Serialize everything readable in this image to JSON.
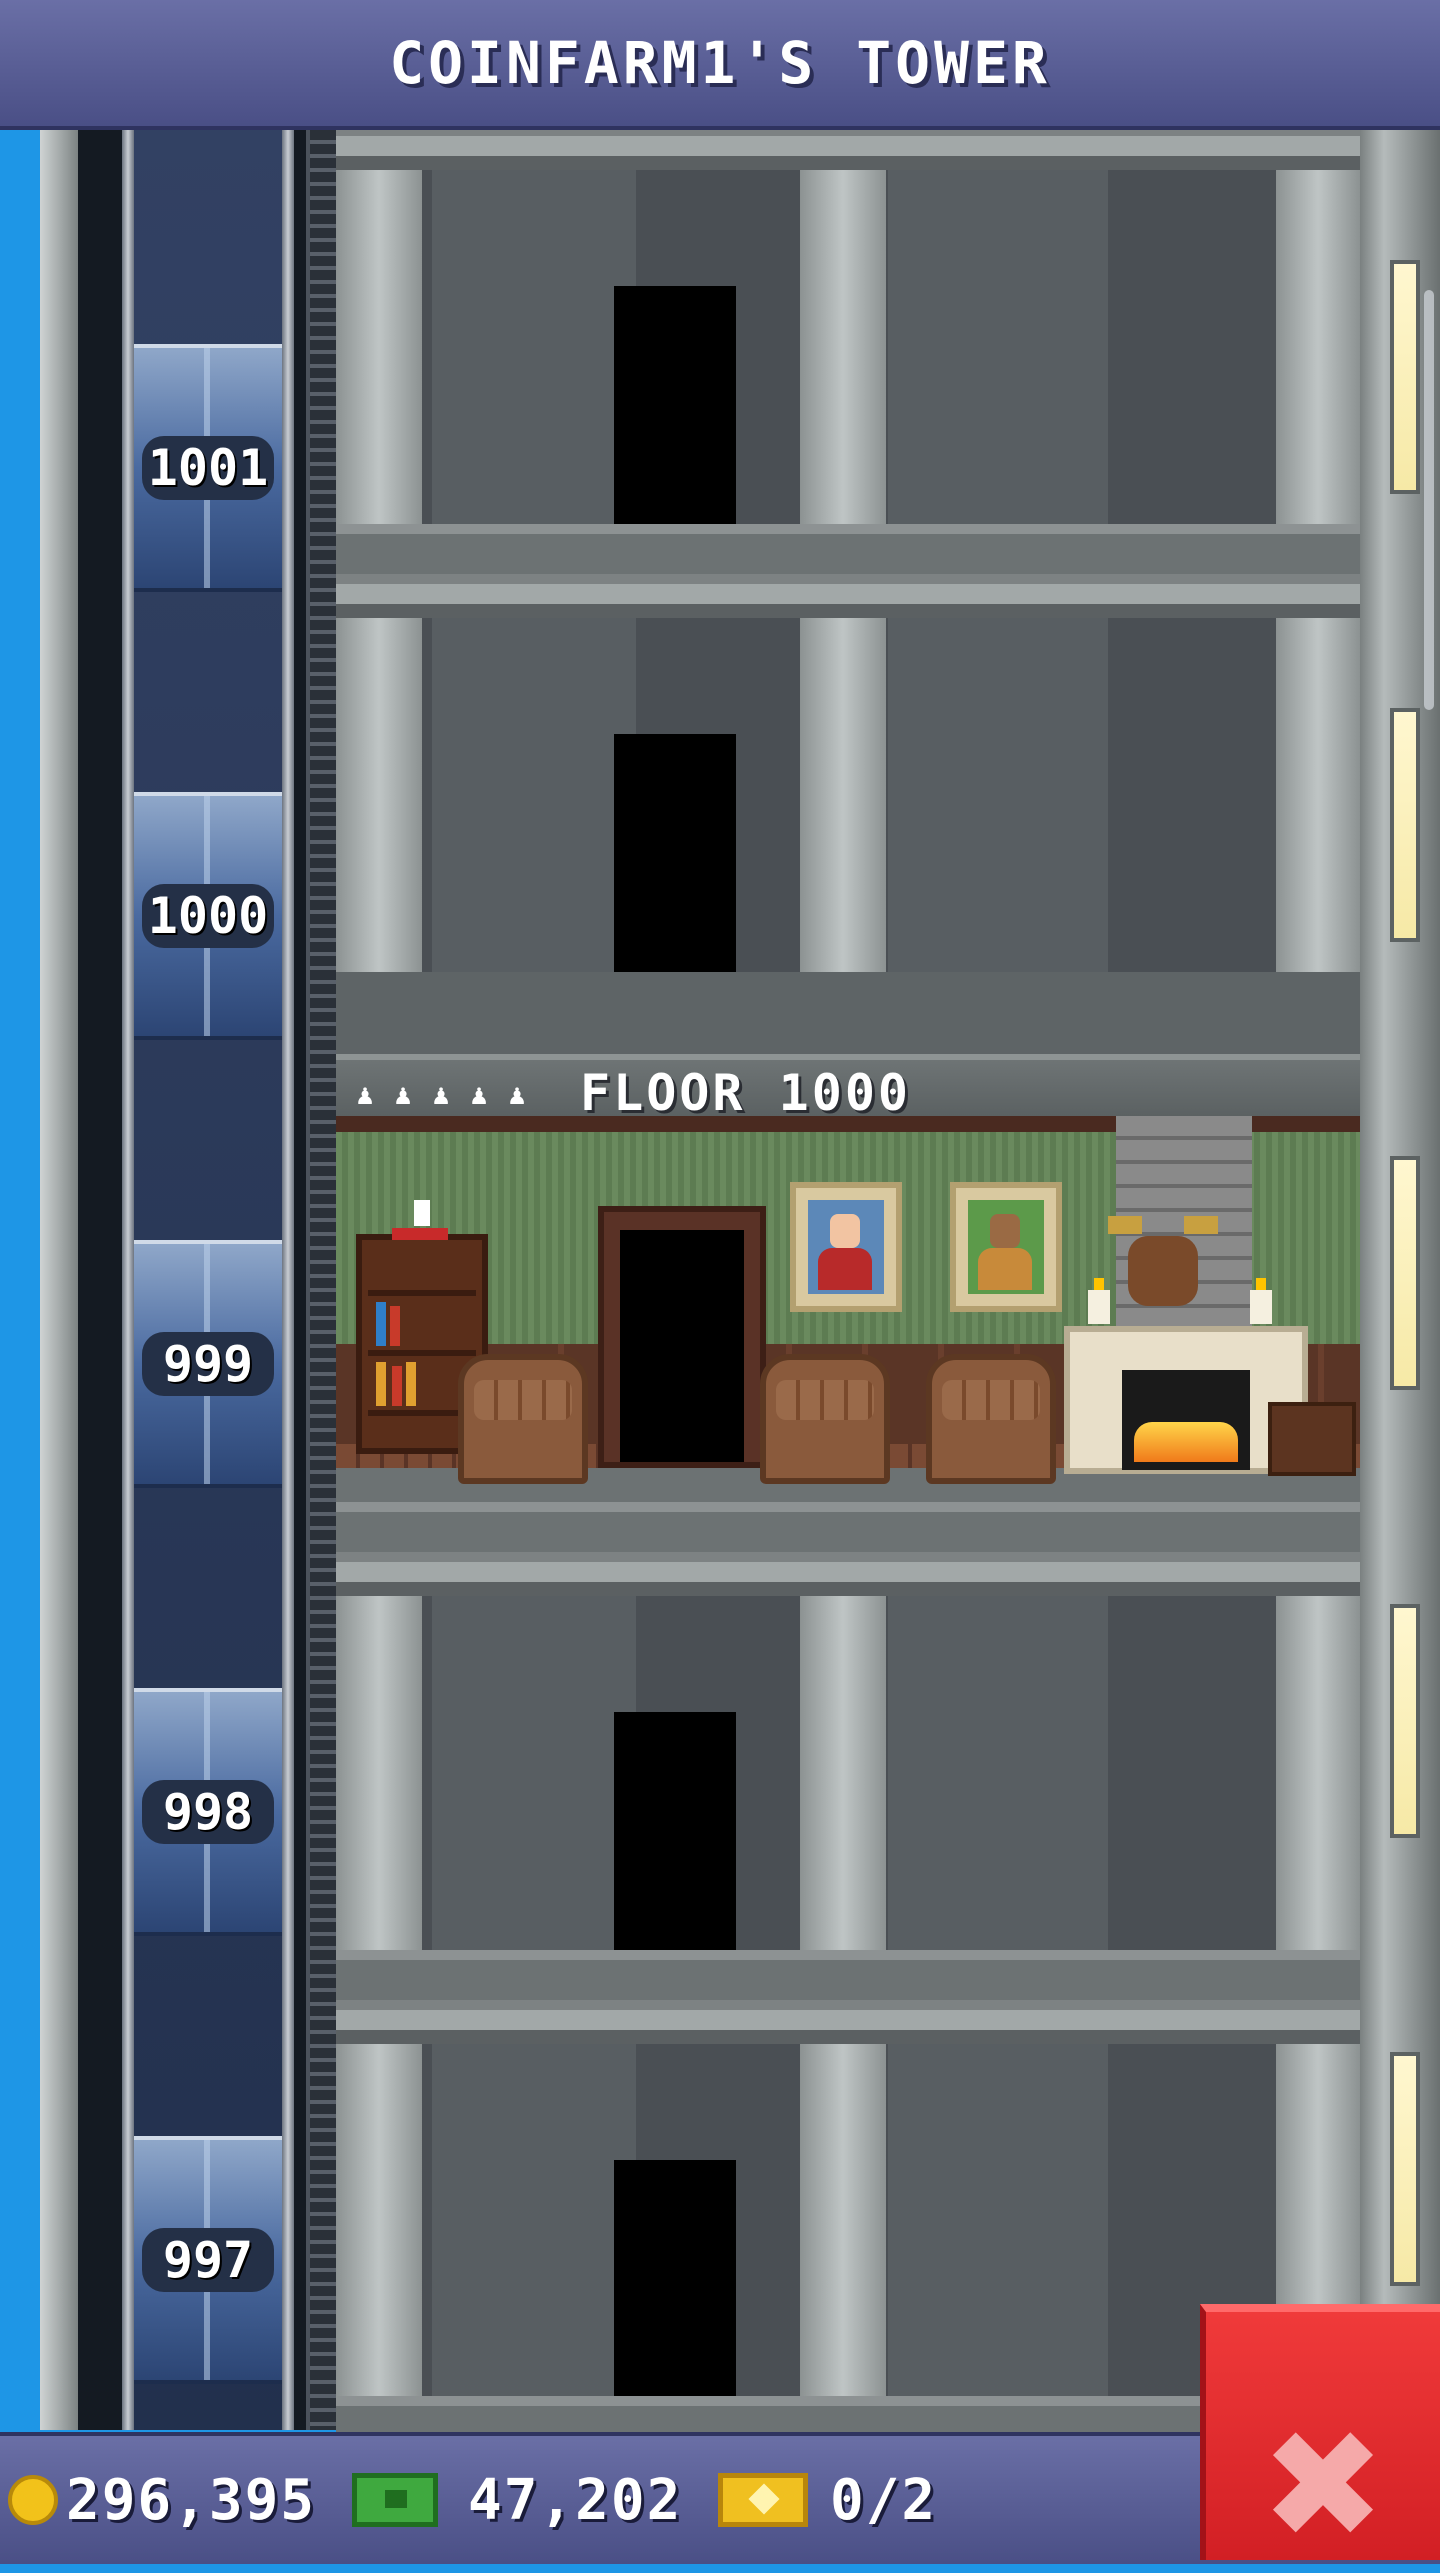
{
  "header": {
    "title": "COINFARM1'S TOWER"
  },
  "elevator": {
    "floor_labels": [
      "1001",
      "1000",
      "999",
      "998",
      "997"
    ]
  },
  "named_floor": {
    "label": "FLOOR 1000",
    "resident_icons": [
      "person-icon",
      "person-icon",
      "person-icon",
      "person-icon",
      "person-icon"
    ]
  },
  "footer": {
    "coins": "296,395",
    "bux": "47,202",
    "vip_tickets": "0/2"
  },
  "colors": {
    "header_bg": "#5a5f96",
    "close_button": "#e02a2e",
    "sky": "#1e96e6"
  }
}
